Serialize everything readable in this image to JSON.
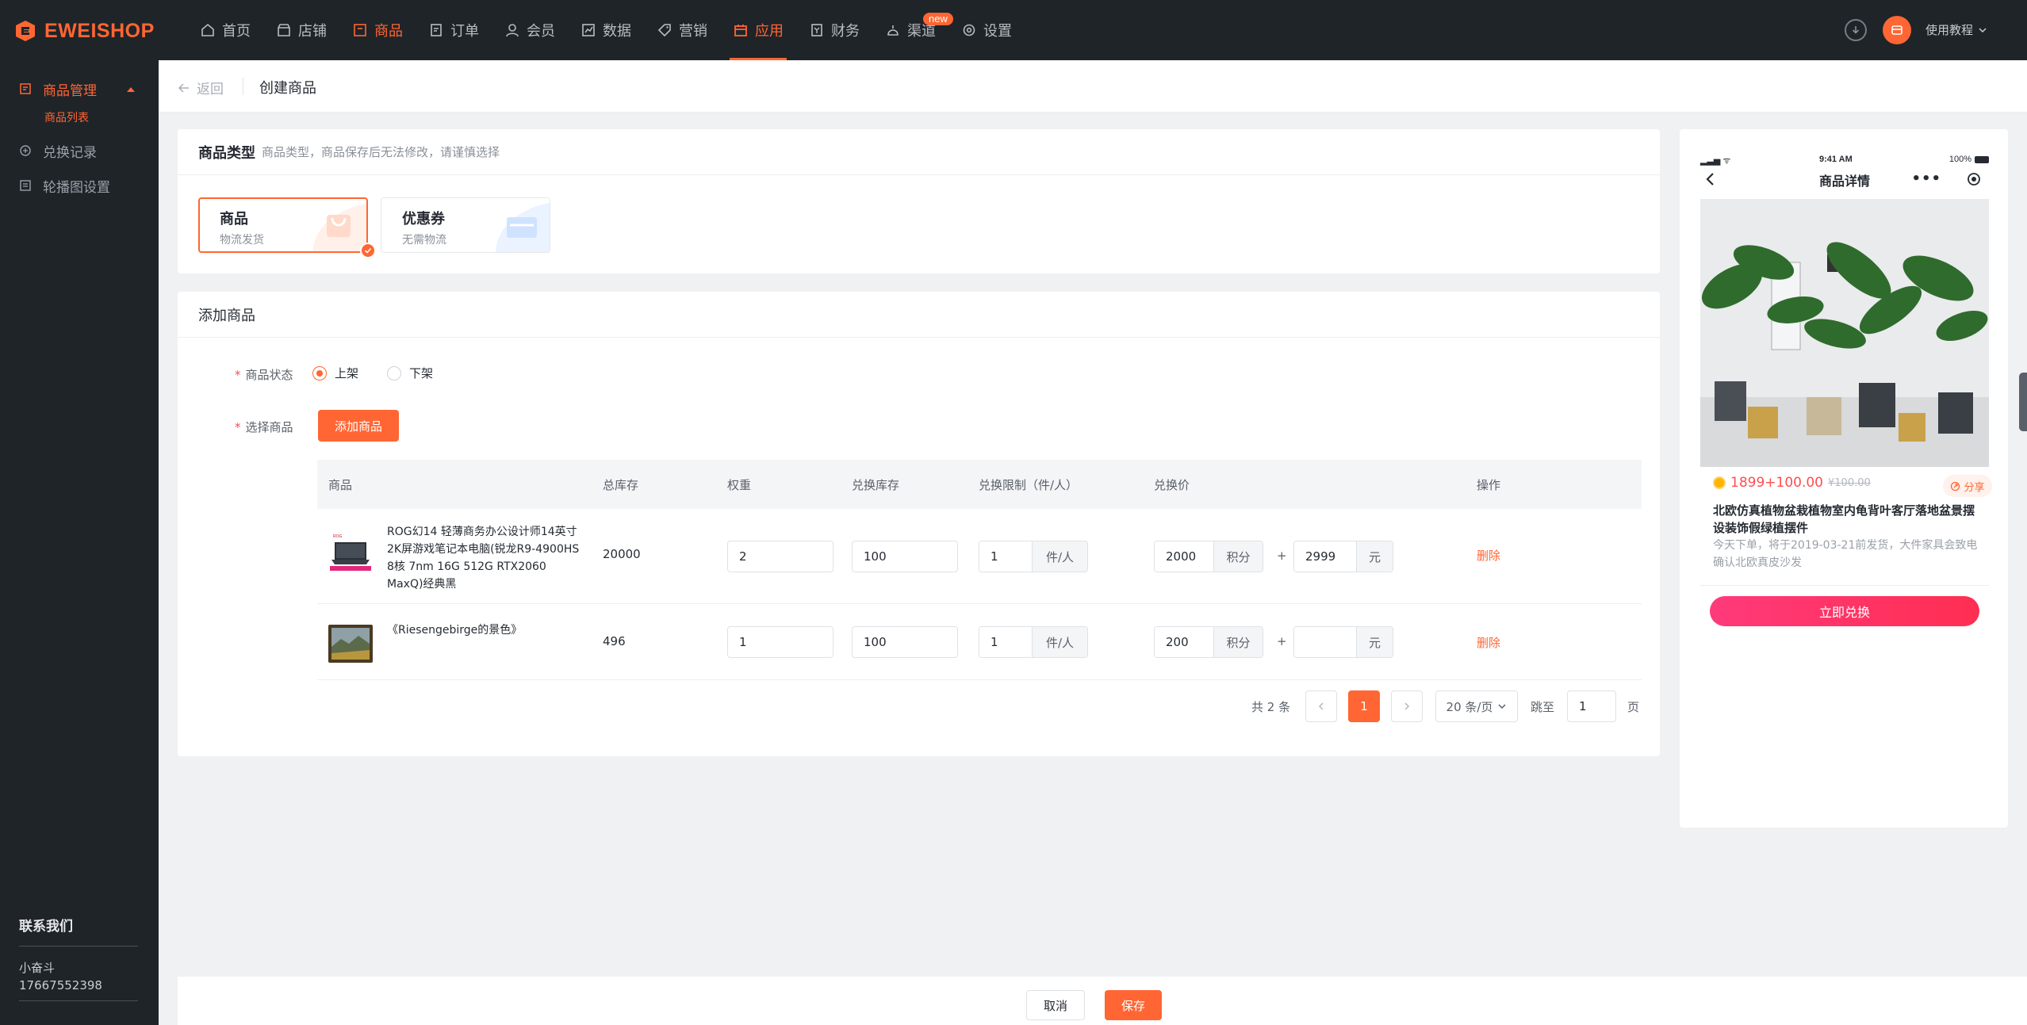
{
  "brand": {
    "name": "EWEISHOP",
    "accent": "#ff6633"
  },
  "nav": [
    {
      "label": "首页",
      "icon": "home-icon"
    },
    {
      "label": "店铺",
      "icon": "store-icon"
    },
    {
      "label": "商品",
      "icon": "goods-icon"
    },
    {
      "label": "订单",
      "icon": "order-icon"
    },
    {
      "label": "会员",
      "icon": "member-icon"
    },
    {
      "label": "数据",
      "icon": "data-icon"
    },
    {
      "label": "营销",
      "icon": "tag-icon"
    },
    {
      "label": "应用",
      "icon": "app-icon",
      "active": true
    },
    {
      "label": "财务",
      "icon": "finance-icon"
    },
    {
      "label": "渠道",
      "icon": "channel-icon",
      "badge": "new"
    },
    {
      "label": "设置",
      "icon": "settings-icon"
    }
  ],
  "top_right": {
    "tutorial_label": "使用教程"
  },
  "sidebar": {
    "group_label": "商品管理",
    "sub_label": "商品列表",
    "items": [
      {
        "label": "兑换记录",
        "icon": "exchange-icon"
      },
      {
        "label": "轮播图设置",
        "icon": "banner-icon"
      }
    ],
    "contact": {
      "title": "联系我们",
      "name": "小奋斗",
      "phone": "17667552398"
    }
  },
  "header": {
    "back_label": "返回",
    "title": "创建商品"
  },
  "type_card": {
    "title": "商品类型",
    "subtitle": "商品类型，商品保存后无法修改，请谨慎选择",
    "options": [
      {
        "title": "商品",
        "desc": "物流发货",
        "selected": true
      },
      {
        "title": "优惠券",
        "desc": "无需物流",
        "selected": false
      }
    ]
  },
  "add_card": {
    "title": "添加商品",
    "status_label": "商品状态",
    "status_options": [
      {
        "label": "上架",
        "checked": true
      },
      {
        "label": "下架",
        "checked": false
      }
    ],
    "select_label": "选择商品",
    "add_button": "添加商品",
    "columns": [
      "商品",
      "总库存",
      "权重",
      "兑换库存",
      "兑换限制（件/人）",
      "兑换价",
      "操作"
    ],
    "rows": [
      {
        "name": "ROG幻14 轻薄商务办公设计师14英寸2K屏游戏笔记本电脑(锐龙R9-4900HS 8核 7nm 16G 512G RTX2060 MaxQ)经典黑",
        "stock": "20000",
        "weight": "2",
        "exchange_stock": "100",
        "limit": "1",
        "limit_unit": "件/人",
        "points": "2000",
        "points_unit": "积分",
        "plus": "+",
        "cash": "2999",
        "cash_unit": "元",
        "action": "删除",
        "thumb": "laptop-thumbnail"
      },
      {
        "name": "《Riesengebirge的景色》",
        "stock": "496",
        "weight": "1",
        "exchange_stock": "100",
        "limit": "1",
        "limit_unit": "件/人",
        "points": "200",
        "points_unit": "积分",
        "plus": "+",
        "cash": "",
        "cash_unit": "元",
        "action": "删除",
        "thumb": "painting-thumbnail"
      }
    ],
    "pagination": {
      "total": "共 2 条",
      "current": "1",
      "page_size": "20 条/页",
      "jump_label": "跳至",
      "jump_value": "1",
      "page_suffix": "页"
    }
  },
  "phone_preview": {
    "time": "9:41 AM",
    "battery": "100%",
    "title": "商品详情",
    "price": "1899+100.00",
    "original_price": "¥100.00",
    "share": "分享",
    "name": "北欧仿真植物盆栽植物室内龟背叶客厅落地盆景摆设装饰假绿植摆件",
    "desc": "今天下单，将于2019-03-21前发货，大件家具会致电确认北欧真皮沙发",
    "button": "立即兑换"
  },
  "footer": {
    "cancel": "取消",
    "save": "保存"
  }
}
